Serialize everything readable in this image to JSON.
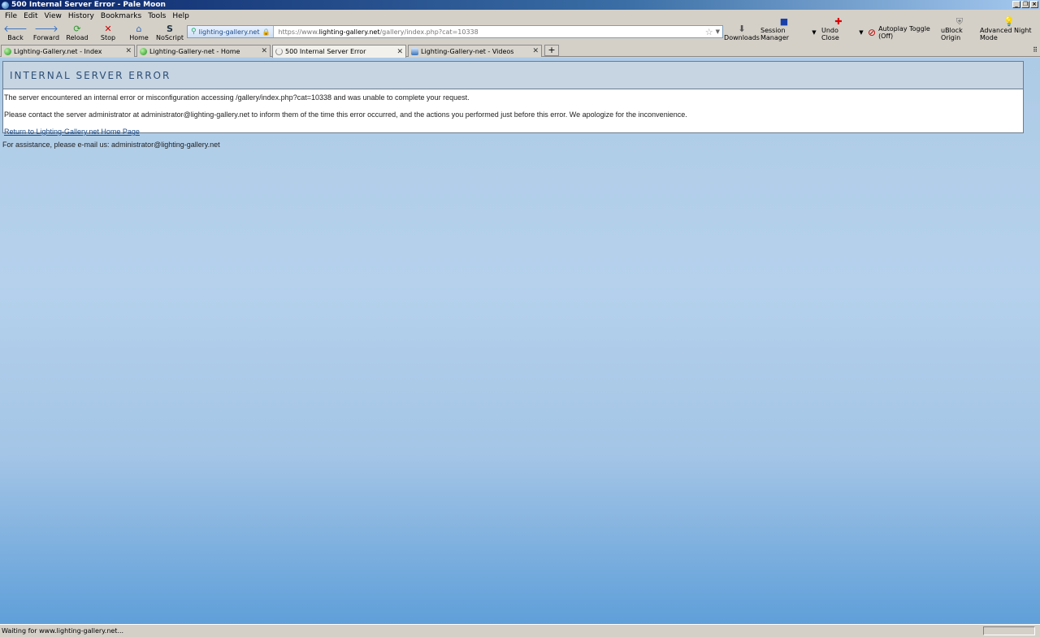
{
  "window": {
    "title": "500 Internal Server Error - Pale Moon"
  },
  "menu": [
    "File",
    "Edit",
    "View",
    "History",
    "Bookmarks",
    "Tools",
    "Help"
  ],
  "toolbar": {
    "back": "Back",
    "forward": "Forward",
    "reload": "Reload",
    "stop": "Stop",
    "home": "Home",
    "noscript": "NoScript",
    "downloads": "Downloads",
    "session_manager": "Session Manager",
    "undo_close": "Undo Close",
    "autoplay": "Autoplay Toggle (Off)",
    "ublock": "uBlock Origin",
    "night_mode": "Advanced Night Mode"
  },
  "urlbar": {
    "identity": "lighting-gallery.net",
    "prefix": "https://www.",
    "host": "lighting-gallery.net",
    "path": "/gallery/index.php?cat=10338"
  },
  "tabs": [
    {
      "label": "Lighting-Gallery.net - Index"
    },
    {
      "label": "Lighting-Gallery-net - Home"
    },
    {
      "label": "500 Internal Server Error"
    },
    {
      "label": "Lighting-Gallery-net - Videos"
    }
  ],
  "page": {
    "heading": "INTERNAL SERVER ERROR",
    "p1": "The server encountered an internal error or misconfiguration accessing /gallery/index.php?cat=10338 and was unable to complete your request.",
    "p2": "Please contact the server administrator at administrator@lighting-gallery.net to inform them of the time this error occurred, and the actions you performed just before this error. We apologize for the inconvenience.",
    "return_link": "Return to Lighting-Gallery.net Home Page",
    "assist": "For assistance, please e-mail us: administrator@lighting-gallery.net"
  },
  "status": {
    "text": "Waiting for www.lighting-gallery.net..."
  }
}
